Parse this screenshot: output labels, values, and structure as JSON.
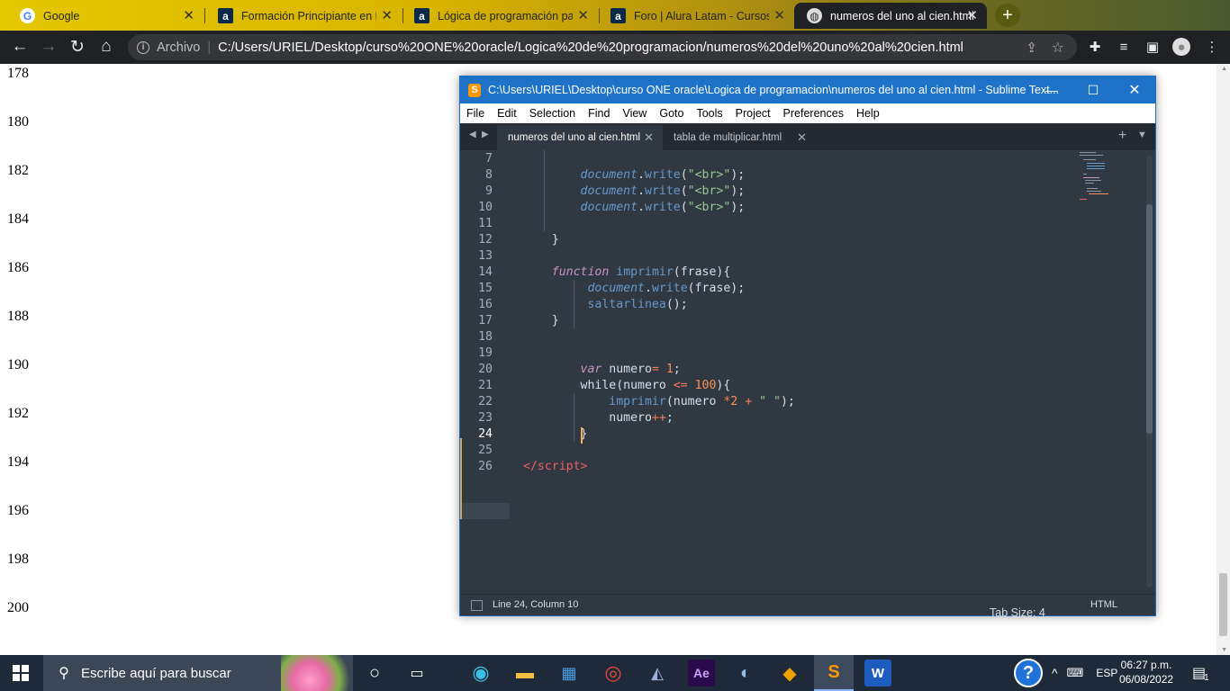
{
  "browser": {
    "tabs": [
      {
        "title": "Google",
        "icon": "google-icon",
        "active": false
      },
      {
        "title": "Formación Principiante en P",
        "icon": "alura-icon",
        "active": false
      },
      {
        "title": "Lógica de programación par",
        "icon": "alura-icon",
        "active": false
      },
      {
        "title": "Foro | Alura Latam - Cursos o",
        "icon": "alura-icon",
        "active": false
      },
      {
        "title": "numeros del uno al cien.html",
        "icon": "globe-icon",
        "active": true
      }
    ],
    "new_tab": "+",
    "address": {
      "scheme_label": "Archivo",
      "url": "C:/Users/URIEL/Desktop/curso%20ONE%20oracle/Logica%20de%20programacion/numeros%20del%20uno%20al%20cien.html"
    }
  },
  "page": {
    "line_numbers": [
      "178",
      "180",
      "182",
      "184",
      "186",
      "188",
      "190",
      "192",
      "194",
      "196",
      "198",
      "200"
    ]
  },
  "sublime": {
    "title": "C:\\Users\\URIEL\\Desktop\\curso ONE oracle\\Logica de programacion\\numeros del uno al cien.html - Sublime Text...",
    "menu": [
      "File",
      "Edit",
      "Selection",
      "Find",
      "View",
      "Goto",
      "Tools",
      "Project",
      "Preferences",
      "Help"
    ],
    "tabs": [
      {
        "label": "numeros del uno al cien.html",
        "active": true
      },
      {
        "label": "tabla de multiplicar.html",
        "active": false
      }
    ],
    "line_numbers": [
      "7",
      "8",
      "9",
      "10",
      "11",
      "12",
      "13",
      "14",
      "15",
      "16",
      "17",
      "18",
      "19",
      "20",
      "21",
      "22",
      "23",
      "24",
      "25",
      "26"
    ],
    "current_line": "24",
    "status": {
      "position": "Line 24, Column 10",
      "tab_size": "Tab Size: 4",
      "syntax": "HTML"
    }
  },
  "taskbar": {
    "search_placeholder": "Escribe aquí para buscar",
    "language": "ESP",
    "time": "06:27 p.m.",
    "date": "06/08/2022",
    "notifications": "1"
  },
  "colors": {
    "sublime_bg": "#303841",
    "sublime_title": "#1e73c8",
    "keyword": "#c594c5",
    "function": "#6699cc",
    "string": "#99c794",
    "number": "#f99157"
  }
}
